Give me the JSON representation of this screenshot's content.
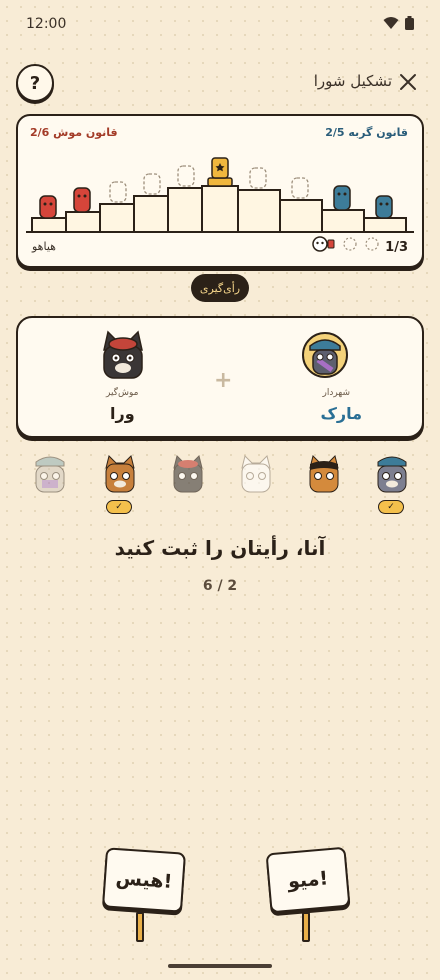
{
  "status": {
    "time": "12:00"
  },
  "header": {
    "title": "تشکیل شورا",
    "help": "?"
  },
  "board": {
    "law_cat": "قانون گربه 2/5",
    "law_mouse": "قانون موش 2/6",
    "left_label": "هیاهو",
    "round": "1/3"
  },
  "vote_pill": "رأی‌گیری",
  "pair": {
    "mayor_role": "شهردار",
    "mayor_name": "مارک",
    "mouse_role": "موش‌گیر",
    "mouse_name": "ورا"
  },
  "cats": [
    {
      "state": "faded",
      "voted": false
    },
    {
      "state": "normal",
      "voted": true
    },
    {
      "state": "faded",
      "voted": false
    },
    {
      "state": "ghost",
      "voted": false
    },
    {
      "state": "normal",
      "voted": false
    },
    {
      "state": "normal",
      "voted": true
    }
  ],
  "prompt": "آنا، رأیتان را ثبت کنید",
  "progress": "6 / 2",
  "buttons": {
    "hiss": "هیس!",
    "meow": "میو!"
  },
  "colors": {
    "cat_team": "#2a5d7a",
    "mouse_team": "#a33b27",
    "accent": "#f4c04c"
  }
}
